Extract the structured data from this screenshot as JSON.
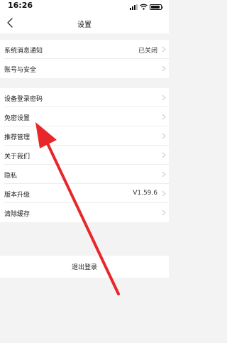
{
  "status_bar": {
    "time": "16:26"
  },
  "nav": {
    "title": "设置",
    "back_icon": "chevron-left-icon"
  },
  "groups": [
    {
      "items": [
        {
          "label": "系统消息通知",
          "value": "已关闭"
        },
        {
          "label": "账号与安全",
          "value": ""
        }
      ]
    },
    {
      "items": [
        {
          "label": "设备登录密码",
          "value": ""
        },
        {
          "label": "免密设置",
          "value": ""
        },
        {
          "label": "推荐管理",
          "value": ""
        },
        {
          "label": "关于我们",
          "value": ""
        },
        {
          "label": "隐私",
          "value": ""
        },
        {
          "label": "版本升级",
          "value": "V1.59.6"
        },
        {
          "label": "清除缓存",
          "value": ""
        }
      ]
    }
  ],
  "logout": {
    "label": "退出登录"
  },
  "annotation": {
    "type": "arrow",
    "color": "#e8272a",
    "points_to": "免密设置"
  },
  "colors": {
    "background": "#f3f3f3",
    "surface": "#ffffff",
    "arrow": "#e8272a"
  }
}
